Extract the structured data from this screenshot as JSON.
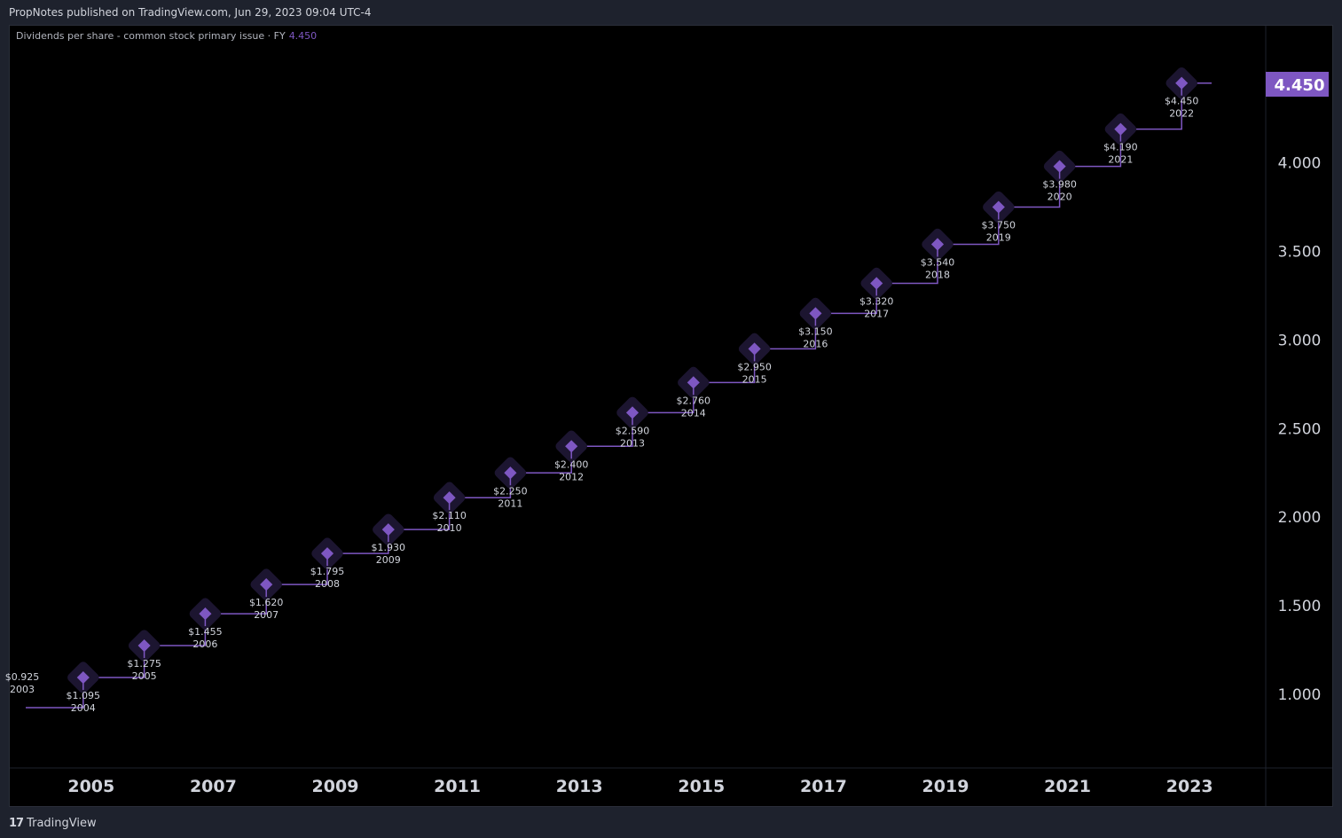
{
  "header": {
    "published": "PropNotes published on TradingView.com, Jun 29, 2023 09:04 UTC-4"
  },
  "legend": {
    "title": "Dividends per share - common stock primary issue · FY",
    "value": "4.450"
  },
  "footer": {
    "brand": "TradingView",
    "logo": "17"
  },
  "colors": {
    "series": "#7e57c2",
    "marker_bg": "#1c1530",
    "badge": "#7e57c2"
  },
  "price_badge": "4.450",
  "chart_data": {
    "type": "line",
    "step": true,
    "title": "Dividends per share - common stock primary issue · FY",
    "x_ticks": [
      "2005",
      "2007",
      "2009",
      "2011",
      "2013",
      "2015",
      "2017",
      "2019",
      "2021",
      "2023"
    ],
    "y_ticks": [
      "1.000",
      "1.500",
      "2.000",
      "2.500",
      "3.000",
      "3.500",
      "4.000"
    ],
    "ylim": [
      0.55,
      4.65
    ],
    "xlim": [
      2003.0,
      2023.7
    ],
    "points": [
      {
        "year": "2003",
        "value": 0.925,
        "label": "$0.925"
      },
      {
        "year": "2004",
        "value": 1.095,
        "label": "$1.095"
      },
      {
        "year": "2005",
        "value": 1.275,
        "label": "$1.275"
      },
      {
        "year": "2006",
        "value": 1.455,
        "label": "$1.455"
      },
      {
        "year": "2007",
        "value": 1.62,
        "label": "$1.620"
      },
      {
        "year": "2008",
        "value": 1.795,
        "label": "$1.795"
      },
      {
        "year": "2009",
        "value": 1.93,
        "label": "$1.930"
      },
      {
        "year": "2010",
        "value": 2.11,
        "label": "$2.110"
      },
      {
        "year": "2011",
        "value": 2.25,
        "label": "$2.250"
      },
      {
        "year": "2012",
        "value": 2.4,
        "label": "$2.400"
      },
      {
        "year": "2013",
        "value": 2.59,
        "label": "$2.590"
      },
      {
        "year": "2014",
        "value": 2.76,
        "label": "$2.760"
      },
      {
        "year": "2015",
        "value": 2.95,
        "label": "$2.950"
      },
      {
        "year": "2016",
        "value": 3.15,
        "label": "$3.150"
      },
      {
        "year": "2017",
        "value": 3.32,
        "label": "$3.320"
      },
      {
        "year": "2018",
        "value": 3.54,
        "label": "$3.540"
      },
      {
        "year": "2019",
        "value": 3.75,
        "label": "$3.750"
      },
      {
        "year": "2020",
        "value": 3.98,
        "label": "$3.980"
      },
      {
        "year": "2021",
        "value": 4.19,
        "label": "$4.190"
      },
      {
        "year": "2022",
        "value": 4.45,
        "label": "$4.450"
      }
    ]
  }
}
